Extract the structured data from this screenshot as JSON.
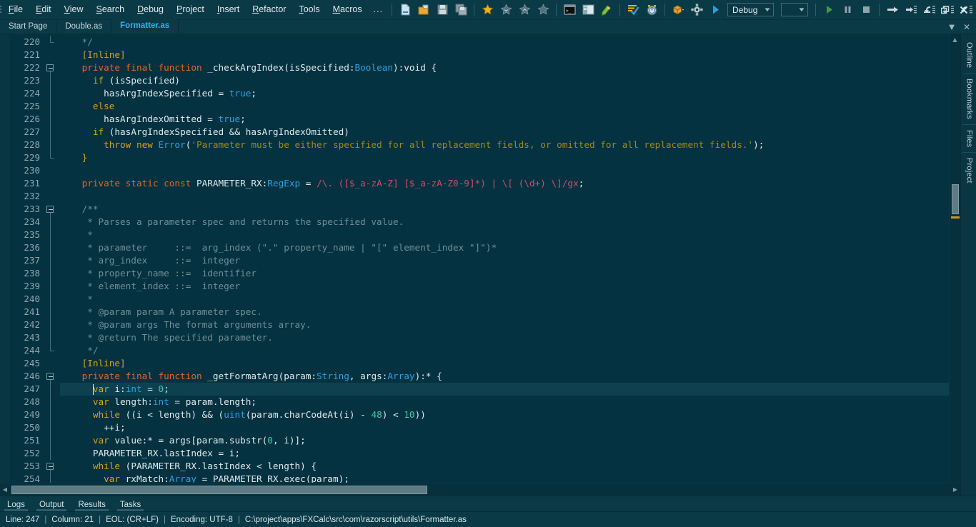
{
  "menu": {
    "items": [
      {
        "label": "File",
        "accel": "F"
      },
      {
        "label": "Edit",
        "accel": "E"
      },
      {
        "label": "View",
        "accel": "V"
      },
      {
        "label": "Search",
        "accel": "S"
      },
      {
        "label": "Debug",
        "accel": "D"
      },
      {
        "label": "Project",
        "accel": "P"
      },
      {
        "label": "Insert",
        "accel": "I"
      },
      {
        "label": "Refactor",
        "accel": "R"
      },
      {
        "label": "Tools",
        "accel": "T"
      },
      {
        "label": "Macros",
        "accel": "M"
      },
      {
        "label": "...",
        "accel": ""
      }
    ],
    "overflow_label": "..."
  },
  "toolbar": {
    "icons": [
      "new-file-icon",
      "open-folder-icon",
      "save-icon",
      "save-all-icon",
      "bookmark-star-filled-icon",
      "bookmark-star-next-icon",
      "bookmark-star-prev-icon",
      "bookmark-star-clear-icon",
      "console-icon",
      "panel-layout-icon",
      "edit-pencil-icon",
      "compile-check-icon",
      "profiler-clock-icon",
      "package-box-icon",
      "settings-gear-icon",
      "run-play-icon"
    ],
    "config_combo": {
      "value": "Debug",
      "placeholder": "Debug"
    },
    "target_combo": {
      "value": "",
      "placeholder": ""
    },
    "debug_icons": [
      "run-green-play-icon",
      "pause-icon",
      "stop-icon",
      "step-over-icon",
      "step-into-icon",
      "step-out-icon",
      "step-into-specific-icon",
      "run-to-cursor-icon"
    ]
  },
  "window_controls": {
    "minimize": "–",
    "restore": "❐",
    "close": "✕"
  },
  "tabs": {
    "items": [
      {
        "label": "Start Page",
        "active": false
      },
      {
        "label": "Double.as",
        "active": false
      },
      {
        "label": "Formatter.as",
        "active": true
      }
    ],
    "list_icon": "chevron-down-icon",
    "close_icon": "close-icon"
  },
  "editor": {
    "first_line_number": 220,
    "current_line": 247,
    "lines": [
      {
        "n": 220,
        "fold": "end",
        "tokens": [
          {
            "t": "    ",
            "c": "plain"
          },
          {
            "t": "*/",
            "c": "cmt"
          }
        ]
      },
      {
        "n": 221,
        "fold": "",
        "tokens": [
          {
            "t": "    ",
            "c": "plain"
          },
          {
            "t": "[Inline]",
            "c": "meta"
          }
        ]
      },
      {
        "n": 222,
        "fold": "box",
        "tokens": [
          {
            "t": "    ",
            "c": "plain"
          },
          {
            "t": "private final function",
            "c": "kw"
          },
          {
            "t": " _checkArgIndex(isSpecified:",
            "c": "plain"
          },
          {
            "t": "Boolean",
            "c": "typ"
          },
          {
            "t": "):void {",
            "c": "plain"
          }
        ]
      },
      {
        "n": 223,
        "fold": "line",
        "tokens": [
          {
            "t": "      ",
            "c": "plain"
          },
          {
            "t": "if",
            "c": "kw2"
          },
          {
            "t": " (isSpecified)",
            "c": "plain"
          }
        ]
      },
      {
        "n": 224,
        "fold": "line",
        "tokens": [
          {
            "t": "        hasArgIndexSpecified = ",
            "c": "plain"
          },
          {
            "t": "true",
            "c": "typ"
          },
          {
            "t": ";",
            "c": "plain"
          }
        ]
      },
      {
        "n": 225,
        "fold": "line",
        "tokens": [
          {
            "t": "      ",
            "c": "plain"
          },
          {
            "t": "else",
            "c": "kw2"
          }
        ]
      },
      {
        "n": 226,
        "fold": "line",
        "tokens": [
          {
            "t": "        hasArgIndexOmitted = ",
            "c": "plain"
          },
          {
            "t": "true",
            "c": "typ"
          },
          {
            "t": ";",
            "c": "plain"
          }
        ]
      },
      {
        "n": 227,
        "fold": "line",
        "tokens": [
          {
            "t": "      ",
            "c": "plain"
          },
          {
            "t": "if",
            "c": "kw2"
          },
          {
            "t": " (hasArgIndexSpecified && hasArgIndexOmitted)",
            "c": "plain"
          }
        ]
      },
      {
        "n": 228,
        "fold": "line",
        "tokens": [
          {
            "t": "        ",
            "c": "plain"
          },
          {
            "t": "throw new",
            "c": "kw2"
          },
          {
            "t": " ",
            "c": "plain"
          },
          {
            "t": "Error",
            "c": "typ"
          },
          {
            "t": "(",
            "c": "plain"
          },
          {
            "t": "'Parameter must be either specified for all replacement fields, or omitted for all replacement fields.'",
            "c": "str"
          },
          {
            "t": ");",
            "c": "plain"
          }
        ]
      },
      {
        "n": 229,
        "fold": "foldend",
        "tokens": [
          {
            "t": "    ",
            "c": "plain"
          },
          {
            "t": "}",
            "c": "br"
          }
        ]
      },
      {
        "n": 230,
        "fold": "",
        "tokens": []
      },
      {
        "n": 231,
        "fold": "",
        "tokens": [
          {
            "t": "    ",
            "c": "plain"
          },
          {
            "t": "private static const",
            "c": "kw"
          },
          {
            "t": " PARAMETER_RX:",
            "c": "plain"
          },
          {
            "t": "RegExp",
            "c": "typ"
          },
          {
            "t": " = ",
            "c": "plain"
          },
          {
            "t": "/\\. ([$_a-zA-Z] [$_a-zA-Z0-9]*) | \\[ (\\d+) \\]/gx",
            "c": "rx"
          },
          {
            "t": ";",
            "c": "plain"
          }
        ]
      },
      {
        "n": 232,
        "fold": "",
        "tokens": []
      },
      {
        "n": 233,
        "fold": "box",
        "tokens": [
          {
            "t": "    ",
            "c": "plain"
          },
          {
            "t": "/**",
            "c": "cmt"
          }
        ]
      },
      {
        "n": 234,
        "fold": "line",
        "tokens": [
          {
            "t": "     ",
            "c": "plain"
          },
          {
            "t": "* Parses a parameter spec and returns the specified value.",
            "c": "cmt"
          }
        ]
      },
      {
        "n": 235,
        "fold": "line",
        "tokens": [
          {
            "t": "     ",
            "c": "plain"
          },
          {
            "t": "*",
            "c": "cmt"
          }
        ]
      },
      {
        "n": 236,
        "fold": "line",
        "tokens": [
          {
            "t": "     ",
            "c": "plain"
          },
          {
            "t": "* parameter     ::=  arg_index (\".\" property_name | \"[\" element_index \"]\")*",
            "c": "cmt"
          }
        ]
      },
      {
        "n": 237,
        "fold": "line",
        "tokens": [
          {
            "t": "     ",
            "c": "plain"
          },
          {
            "t": "* arg_index     ::=  integer",
            "c": "cmt"
          }
        ]
      },
      {
        "n": 238,
        "fold": "line",
        "tokens": [
          {
            "t": "     ",
            "c": "plain"
          },
          {
            "t": "* property_name ::=  identifier",
            "c": "cmt"
          }
        ]
      },
      {
        "n": 239,
        "fold": "line",
        "tokens": [
          {
            "t": "     ",
            "c": "plain"
          },
          {
            "t": "* element_index ::=  integer",
            "c": "cmt"
          }
        ]
      },
      {
        "n": 240,
        "fold": "line",
        "tokens": [
          {
            "t": "     ",
            "c": "plain"
          },
          {
            "t": "*",
            "c": "cmt"
          }
        ]
      },
      {
        "n": 241,
        "fold": "line",
        "tokens": [
          {
            "t": "     ",
            "c": "plain"
          },
          {
            "t": "* ",
            "c": "cmt"
          },
          {
            "t": "@param",
            "c": "cmt"
          },
          {
            "t": " param A parameter spec.",
            "c": "cmt"
          }
        ]
      },
      {
        "n": 242,
        "fold": "line",
        "tokens": [
          {
            "t": "     ",
            "c": "plain"
          },
          {
            "t": "* @param args The format arguments array.",
            "c": "cmt"
          }
        ]
      },
      {
        "n": 243,
        "fold": "line",
        "tokens": [
          {
            "t": "     ",
            "c": "plain"
          },
          {
            "t": "* @return The specified parameter.",
            "c": "cmt"
          }
        ]
      },
      {
        "n": 244,
        "fold": "foldend",
        "tokens": [
          {
            "t": "     ",
            "c": "plain"
          },
          {
            "t": "*/",
            "c": "cmt"
          }
        ]
      },
      {
        "n": 245,
        "fold": "",
        "tokens": [
          {
            "t": "    ",
            "c": "plain"
          },
          {
            "t": "[Inline]",
            "c": "meta"
          }
        ]
      },
      {
        "n": 246,
        "fold": "box",
        "tokens": [
          {
            "t": "    ",
            "c": "plain"
          },
          {
            "t": "private final function",
            "c": "kw"
          },
          {
            "t": " _getFormatArg(param:",
            "c": "plain"
          },
          {
            "t": "String",
            "c": "typ"
          },
          {
            "t": ", args:",
            "c": "plain"
          },
          {
            "t": "Array",
            "c": "typ"
          },
          {
            "t": "):* {",
            "c": "plain"
          }
        ]
      },
      {
        "n": 247,
        "fold": "line",
        "tokens": [
          {
            "t": "      ",
            "c": "plain"
          },
          {
            "t": "var",
            "c": "kw2"
          },
          {
            "t": " i:",
            "c": "plain"
          },
          {
            "t": "int",
            "c": "typ"
          },
          {
            "t": " = ",
            "c": "plain"
          },
          {
            "t": "0",
            "c": "num"
          },
          {
            "t": ";",
            "c": "plain"
          }
        ]
      },
      {
        "n": 248,
        "fold": "line",
        "tokens": [
          {
            "t": "      ",
            "c": "plain"
          },
          {
            "t": "var",
            "c": "kw2"
          },
          {
            "t": " length:",
            "c": "plain"
          },
          {
            "t": "int",
            "c": "typ"
          },
          {
            "t": " = param.length;",
            "c": "plain"
          }
        ]
      },
      {
        "n": 249,
        "fold": "line",
        "tokens": [
          {
            "t": "      ",
            "c": "plain"
          },
          {
            "t": "while",
            "c": "kw2"
          },
          {
            "t": " ((i < length) && (",
            "c": "plain"
          },
          {
            "t": "uint",
            "c": "typ"
          },
          {
            "t": "(param.charCodeAt(i) - ",
            "c": "plain"
          },
          {
            "t": "48",
            "c": "num"
          },
          {
            "t": ") < ",
            "c": "plain"
          },
          {
            "t": "10",
            "c": "num"
          },
          {
            "t": "))",
            "c": "plain"
          }
        ]
      },
      {
        "n": 250,
        "fold": "line",
        "tokens": [
          {
            "t": "        ++i;",
            "c": "plain"
          }
        ]
      },
      {
        "n": 251,
        "fold": "line",
        "tokens": [
          {
            "t": "      ",
            "c": "plain"
          },
          {
            "t": "var",
            "c": "kw2"
          },
          {
            "t": " value:* = args[param.substr(",
            "c": "plain"
          },
          {
            "t": "0",
            "c": "num"
          },
          {
            "t": ", i)];",
            "c": "plain"
          }
        ]
      },
      {
        "n": 252,
        "fold": "line",
        "tokens": [
          {
            "t": "      PARAMETER_RX.lastIndex = i;",
            "c": "plain"
          }
        ]
      },
      {
        "n": 253,
        "fold": "box",
        "tokens": [
          {
            "t": "      ",
            "c": "plain"
          },
          {
            "t": "while",
            "c": "kw2"
          },
          {
            "t": " (PARAMETER_RX.lastIndex < length) {",
            "c": "plain"
          }
        ]
      },
      {
        "n": 254,
        "fold": "line",
        "tokens": [
          {
            "t": "        ",
            "c": "plain"
          },
          {
            "t": "var",
            "c": "kw2"
          },
          {
            "t": " rxMatch:",
            "c": "plain"
          },
          {
            "t": "Array",
            "c": "typ"
          },
          {
            "t": " = PARAMETER_RX.exec(param);",
            "c": "plain"
          }
        ]
      }
    ]
  },
  "right_dock": {
    "tabs": [
      "Outline",
      "Bookmarks",
      "Files",
      "Project"
    ]
  },
  "bottom_tabs": {
    "items": [
      "Logs",
      "Output",
      "Results",
      "Tasks"
    ]
  },
  "status_bar": {
    "line": "Line: 247",
    "column": "Column: 21",
    "eol": "EOL: (CR+LF)",
    "encoding": "Encoding: UTF-8",
    "path": "C:\\project\\apps\\FXCalc\\src\\com\\razorscript\\utils\\Formatter.as",
    "separator": "|"
  },
  "colors": {
    "bg": "#053240",
    "chrome": "#0b3a47",
    "accent": "#2bb3ef",
    "keyword": "#e2662c",
    "keyword2": "#d7a21a",
    "type": "#2b9fe0",
    "string": "#a38a16",
    "comment": "#6f8e98",
    "number": "#3fc7a8",
    "regex": "#d24b6a",
    "scroll_marker": "#d09a12"
  }
}
